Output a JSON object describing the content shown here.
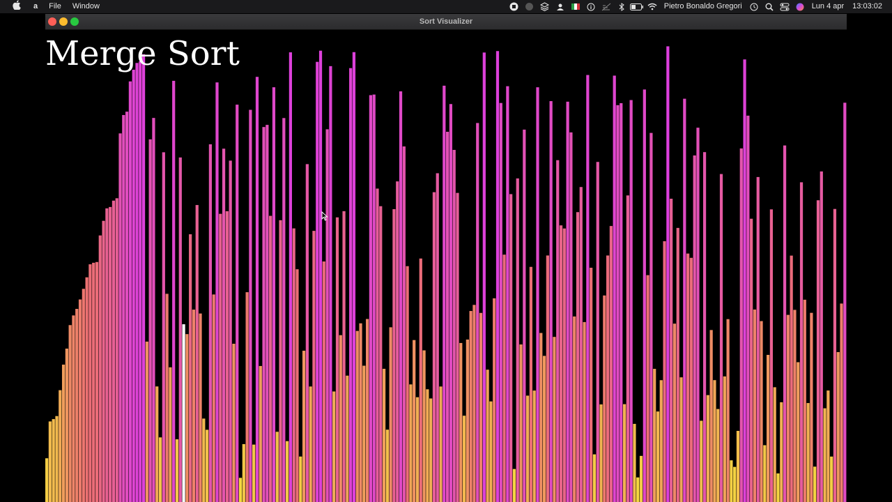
{
  "menubar": {
    "app_name": "a",
    "menus": [
      "File",
      "Window"
    ],
    "user_name": "Pietro Bonaldo Gregori",
    "date": "Lun 4 apr",
    "time": "13:03:02",
    "status_icons": [
      "stop-record-icon",
      "extension-icon",
      "layers-icon",
      "user-icon",
      "italy-flag-icon",
      "info-icon",
      "battery-crossed-icon",
      "bluetooth-icon",
      "battery-icon",
      "wifi-icon",
      "time-machine-icon",
      "search-icon",
      "control-center-icon",
      "siri-icon"
    ]
  },
  "window": {
    "title": "Sort Visualizer"
  },
  "visualizer": {
    "algorithm": "Merge Sort",
    "bar_count": 240,
    "sorted_prefix_count": 30,
    "pointer_index": 41,
    "colors": {
      "low": "#f6e53a",
      "mid": "#ec6f73",
      "high": "#dd3fde",
      "pointer": "#ffffff",
      "background": "#000000"
    }
  },
  "chart_data": {
    "type": "bar",
    "title": "Merge Sort",
    "bar_count": 240,
    "sorted_prefix_count": 30,
    "pointer_index": 41,
    "value_range": [
      0,
      1
    ]
  }
}
